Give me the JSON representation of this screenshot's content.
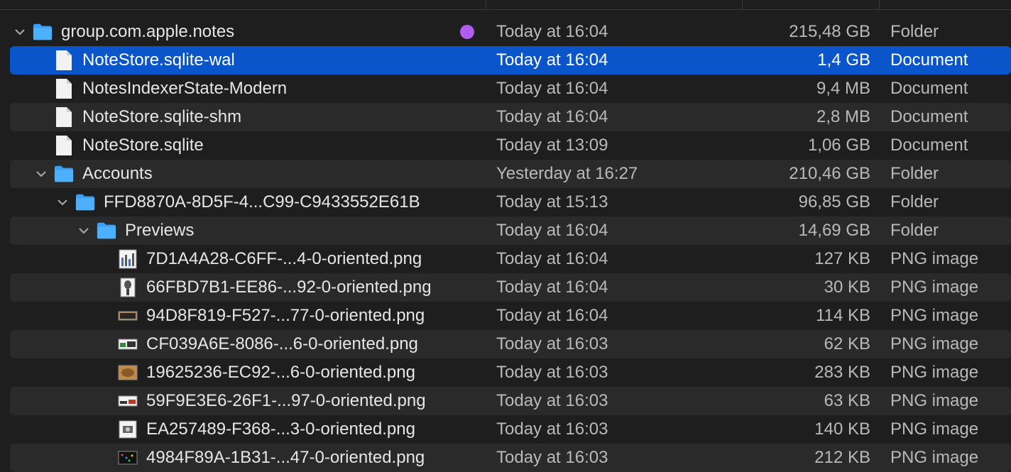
{
  "rows": [
    {
      "name": "group.com.apple.notes",
      "date": "Today at 16:04",
      "size": "215,48 GB",
      "kind": "Folder",
      "icon": "folder-icon"
    },
    {
      "name": "NoteStore.sqlite-wal",
      "date": "Today at 16:04",
      "size": "1,4 GB",
      "kind": "Document",
      "icon": "document-icon"
    },
    {
      "name": "NotesIndexerState-Modern",
      "date": "Today at 16:04",
      "size": "9,4 MB",
      "kind": "Document",
      "icon": "document-icon"
    },
    {
      "name": "NoteStore.sqlite-shm",
      "date": "Today at 16:04",
      "size": "2,8 MB",
      "kind": "Document",
      "icon": "document-icon"
    },
    {
      "name": "NoteStore.sqlite",
      "date": "Today at 13:09",
      "size": "1,06 GB",
      "kind": "Document",
      "icon": "document-icon"
    },
    {
      "name": "Accounts",
      "date": "Yesterday at 16:27",
      "size": "210,46 GB",
      "kind": "Folder",
      "icon": "folder-icon"
    },
    {
      "name": "FFD8870A-8D5F-4...C99-C9433552E61B",
      "date": "Today at 15:13",
      "size": "96,85 GB",
      "kind": "Folder",
      "icon": "folder-icon"
    },
    {
      "name": "Previews",
      "date": "Today at 16:04",
      "size": "14,69 GB",
      "kind": "Folder",
      "icon": "folder-icon"
    },
    {
      "name": "7D1A4A28-C6FF-...4-0-oriented.png",
      "date": "Today at 16:04",
      "size": "127 KB",
      "kind": "PNG image",
      "icon": "image-thumbnail-icon"
    },
    {
      "name": "66FBD7B1-EE86-...92-0-oriented.png",
      "date": "Today at 16:04",
      "size": "30 KB",
      "kind": "PNG image",
      "icon": "image-thumbnail-icon"
    },
    {
      "name": "94D8F819-F527-...77-0-oriented.png",
      "date": "Today at 16:04",
      "size": "114 KB",
      "kind": "PNG image",
      "icon": "image-thumbnail-icon"
    },
    {
      "name": "CF039A6E-8086-...6-0-oriented.png",
      "date": "Today at 16:03",
      "size": "62 KB",
      "kind": "PNG image",
      "icon": "image-thumbnail-icon"
    },
    {
      "name": "19625236-EC92-...6-0-oriented.png",
      "date": "Today at 16:03",
      "size": "283 KB",
      "kind": "PNG image",
      "icon": "image-thumbnail-icon"
    },
    {
      "name": "59F9E3E6-26F1-...97-0-oriented.png",
      "date": "Today at 16:03",
      "size": "63 KB",
      "kind": "PNG image",
      "icon": "image-thumbnail-icon"
    },
    {
      "name": "EA257489-F368-...3-0-oriented.png",
      "date": "Today at 16:03",
      "size": "140 KB",
      "kind": "PNG image",
      "icon": "image-thumbnail-icon"
    },
    {
      "name": "4984F89A-1B31-...47-0-oriented.png",
      "date": "Today at 16:03",
      "size": "212 KB",
      "kind": "PNG image",
      "icon": "image-thumbnail-icon"
    }
  ],
  "colors": {
    "selection": "#0a55c9",
    "folder": "#3aa0f5",
    "tag": "#b15cf0"
  }
}
